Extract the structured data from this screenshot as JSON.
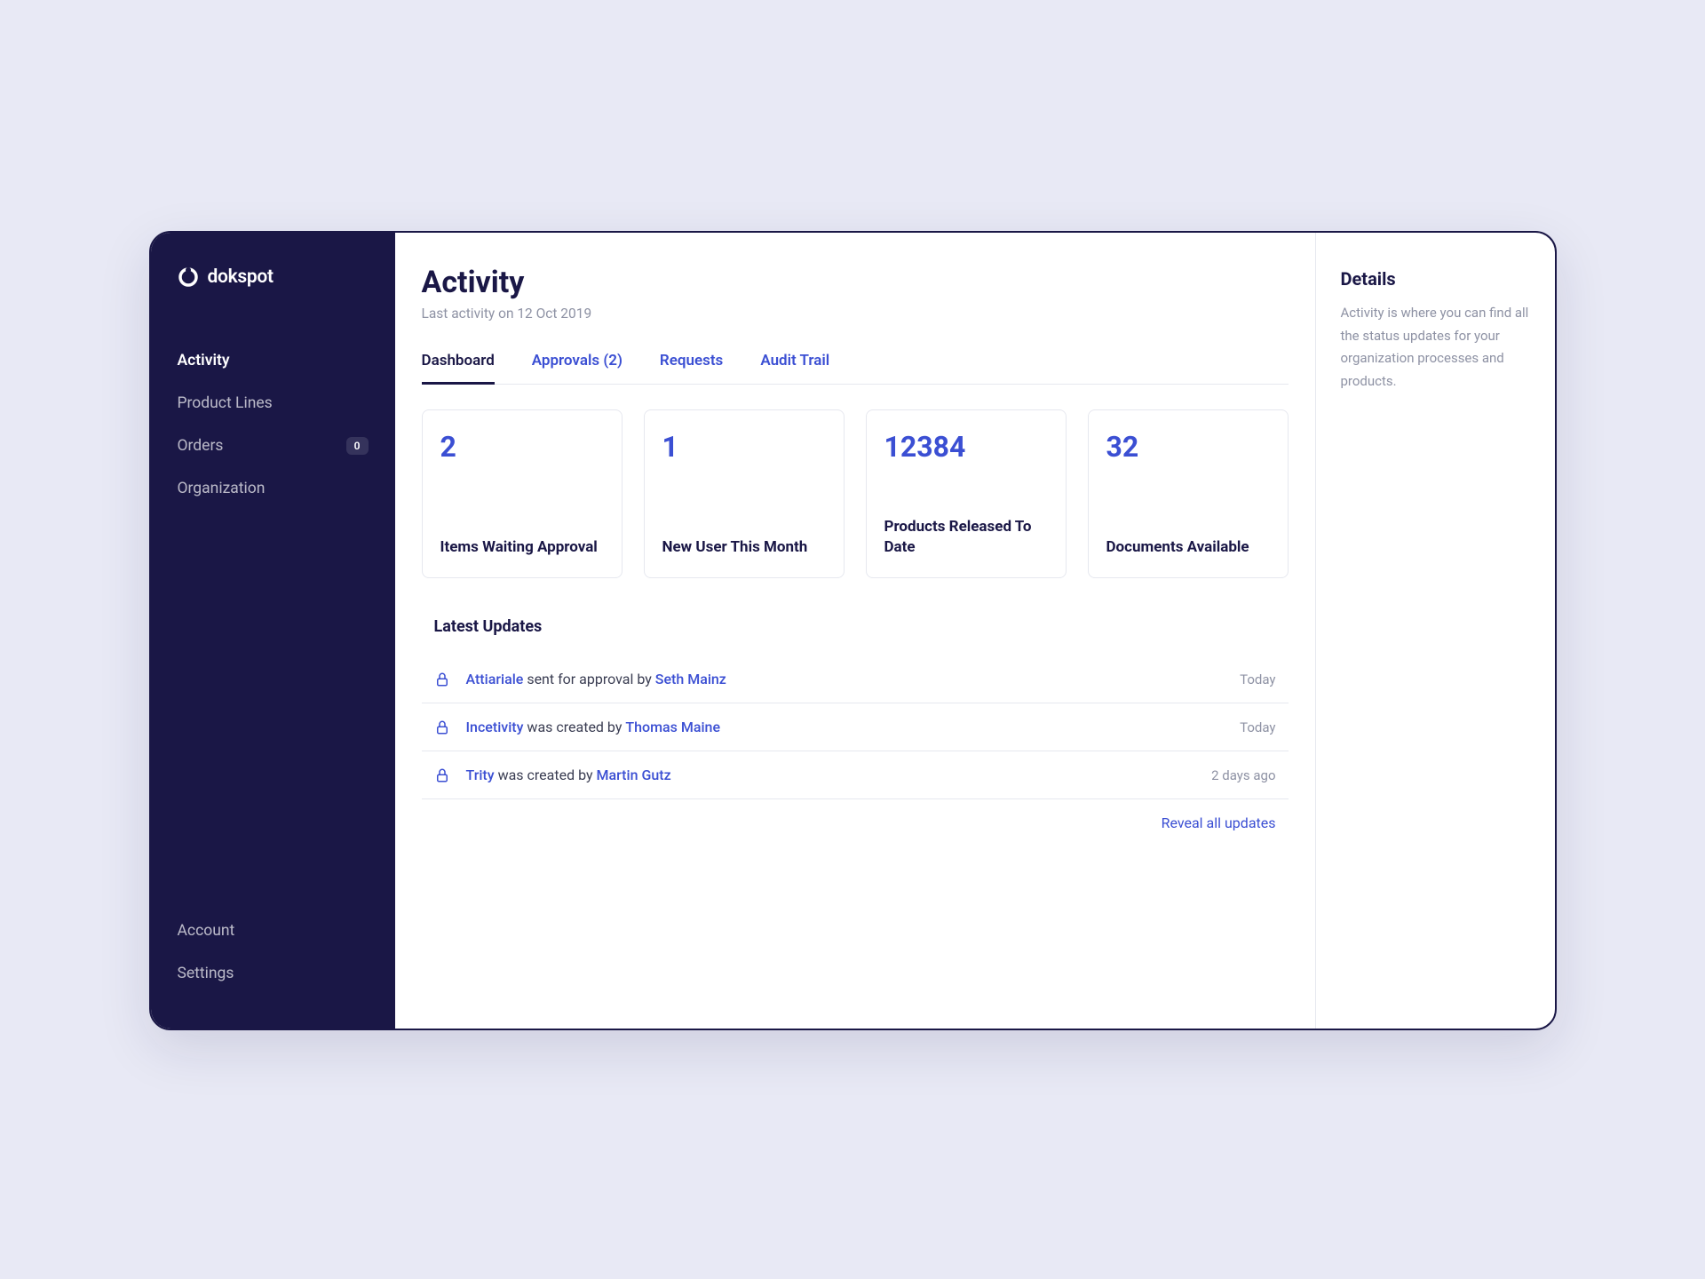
{
  "brand": {
    "name": "dokspot"
  },
  "sidebar": {
    "nav": [
      {
        "label": "Activity",
        "active": true
      },
      {
        "label": "Product Lines"
      },
      {
        "label": "Orders",
        "badge": "0"
      },
      {
        "label": "Organization"
      }
    ],
    "bottom": [
      {
        "label": "Account"
      },
      {
        "label": "Settings"
      }
    ]
  },
  "header": {
    "title": "Activity",
    "subtitle": "Last activity on 12 Oct 2019"
  },
  "tabs": [
    {
      "label": "Dashboard",
      "active": true
    },
    {
      "label": "Approvals (2)"
    },
    {
      "label": "Requests"
    },
    {
      "label": "Audit Trail"
    }
  ],
  "stats": [
    {
      "value": "2",
      "label": "Items Waiting Approval"
    },
    {
      "value": "1",
      "label": "New User This Month"
    },
    {
      "value": "12384",
      "label": "Products Released To Date"
    },
    {
      "value": "32",
      "label": "Documents Available"
    }
  ],
  "updates": {
    "heading": "Latest Updates",
    "items": [
      {
        "subject": "Attiariale",
        "middle": " sent for approval by ",
        "actor": "Seth Mainz",
        "time": "Today"
      },
      {
        "subject": "Incetivity",
        "middle": " was created by ",
        "actor": "Thomas Maine",
        "time": "Today"
      },
      {
        "subject": "Trity",
        "middle": " was created by ",
        "actor": "Martin Gutz",
        "time": "2 days ago"
      }
    ],
    "reveal": "Reveal all updates"
  },
  "details": {
    "title": "Details",
    "body": "Activity is where you can find all the status updates for your organization processes and products."
  }
}
